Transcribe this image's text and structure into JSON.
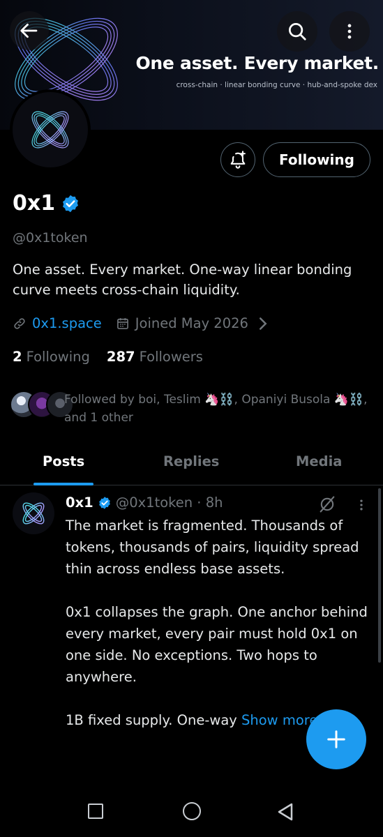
{
  "banner": {
    "title": "One asset. Every market.",
    "subtitle": "cross-chain · linear bonding curve · hub-and-spoke dex"
  },
  "header": {
    "back_icon": "arrow-left-icon",
    "search_icon": "search-icon",
    "more_icon": "more-vertical-icon"
  },
  "profile": {
    "name": "0x1",
    "handle": "@0x1token",
    "bio": "One asset. Every market. One-way linear bonding curve meets cross-chain liquidity.",
    "website": "0x1.space",
    "joined": "Joined May 2026",
    "following_count": "2",
    "following_label": "Following",
    "followers_count": "287",
    "followers_label": "Followers",
    "followed_by": "Followed by boi, Teslim 🦄⛓️, Opaniyi Busola 🦄⛓️, and 1 other"
  },
  "actions": {
    "follow_label": "Following",
    "notify_icon": "bell-plus-icon"
  },
  "tabs": [
    {
      "label": "Posts",
      "active": true
    },
    {
      "label": "Replies",
      "active": false
    },
    {
      "label": "Media",
      "active": false
    }
  ],
  "post": {
    "name": "0x1",
    "handle": "@0x1token · 8h",
    "paragraphs": [
      "The market is fragmented. Thousands of tokens, thousands of pairs, liquidity spread thin across endless base assets.",
      "0x1 collapses the graph. One anchor behind every market, every pair must hold 0x1 on one side. No exceptions. Two hops to anywhere.",
      "1B fixed supply. One-way "
    ],
    "show_more": "Show more"
  },
  "colors": {
    "accent": "#1d9bf0",
    "muted": "#71767b",
    "background": "#000000",
    "text": "#e7e9ea"
  }
}
